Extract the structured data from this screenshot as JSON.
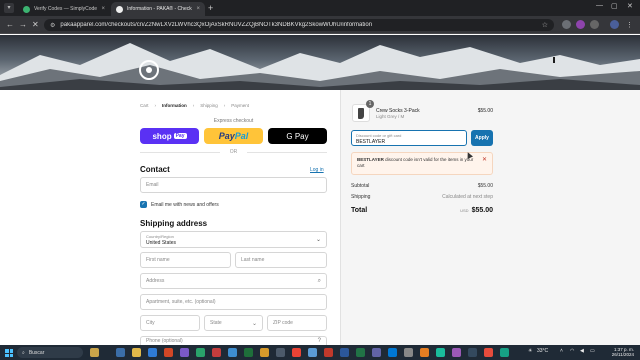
{
  "browser": {
    "tabs": [
      {
        "title": "Verify Codes — SimplyCodes",
        "active": false
      },
      {
        "title": "Information - PAKA® - Checkout",
        "active": true
      }
    ],
    "url": "pakaapparel.com/checkouts/cn/Z2NwLXVzLWVhc3QxOjAxSkRNUVZZQjBNOTk3NDBKVkg2SkowWUhU/information",
    "new_tab": "+",
    "close_glyph": "×"
  },
  "breadcrumb": {
    "items": [
      "Cart",
      "Information",
      "Shipping",
      "Payment"
    ],
    "separator": "›"
  },
  "express": {
    "label": "Express checkout",
    "shop_pay": "shop",
    "shop_pay_badge": "Pay",
    "paypal_a": "Pay",
    "paypal_b": "Pal",
    "gpay": "G Pay",
    "or": "OR"
  },
  "contact": {
    "heading": "Contact",
    "login": "Log in",
    "email_placeholder": "Email",
    "newsletter_label": "Email me with news and offers",
    "newsletter_checked": true
  },
  "shipping": {
    "heading": "Shipping address",
    "country_label": "Country/Region",
    "country_value": "United States",
    "first_name": "First name",
    "last_name": "Last name",
    "address": "Address",
    "apartment": "Apartment, suite, etc. (optional)",
    "city": "City",
    "state": "State",
    "zip": "ZIP code",
    "phone": "Phone (optional)"
  },
  "summary": {
    "quantity": "1",
    "product_name": "Crew Socks 3-Pack",
    "product_variant": "Light Grey / M",
    "product_price": "$55.00",
    "discount_label": "Discount code or gift card",
    "discount_value": "BESTLAYER",
    "apply": "Apply",
    "alert_code": "BESTLAYER",
    "alert_text": " discount code isn't valid for the items in your cart",
    "subtotal_label": "Subtotal",
    "subtotal_value": "$55.00",
    "shipping_label": "Shipping",
    "shipping_value": "Calculated at next step",
    "total_label": "Total",
    "total_currency": "USD",
    "total_value": "$55.00"
  },
  "taskbar": {
    "search": "Buscar",
    "temperature": "33°C",
    "time": "1:37 p. m.",
    "date": "26/11/2024"
  },
  "colors": {
    "accent": "#1773b0",
    "shop_pay": "#5a31f4",
    "paypal": "#ffc439",
    "alert_bg": "#fff4ec"
  }
}
